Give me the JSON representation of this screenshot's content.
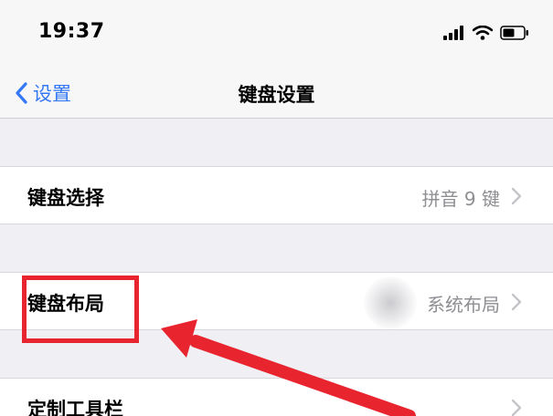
{
  "status_bar": {
    "time": "19:37",
    "icons": [
      "signal-icon",
      "wifi-icon",
      "battery-icon"
    ]
  },
  "nav": {
    "back_label": "设置",
    "title": "键盘设置"
  },
  "rows": [
    {
      "label": "键盘选择",
      "value": "拼音 9 键"
    },
    {
      "label": "键盘布局",
      "value": "系统布局"
    },
    {
      "label": "定制工具栏",
      "value": ""
    }
  ],
  "colors": {
    "accent": "#3478f6",
    "annotation": "#e8242f",
    "background": "#efeff4"
  }
}
